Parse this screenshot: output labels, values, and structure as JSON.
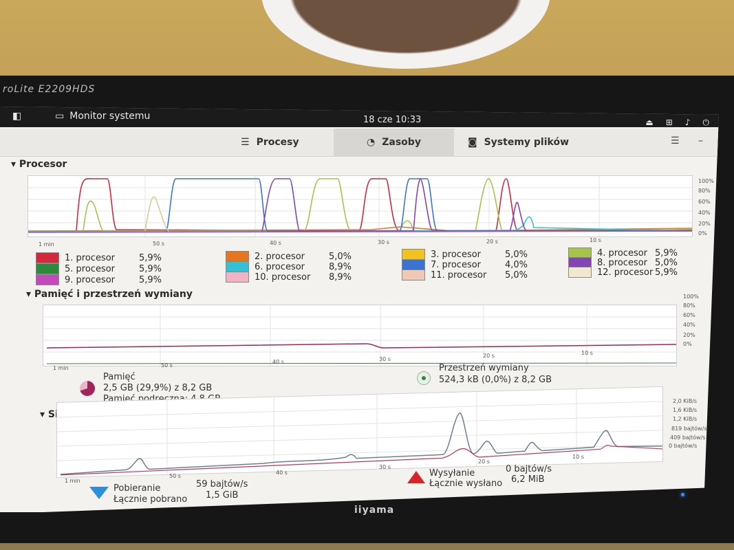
{
  "monitor": {
    "brand_top": "roLite E2209HDS",
    "brand_bottom": "iiyama"
  },
  "topbar": {
    "app_title": "Monitor systemu",
    "clock": "18 cze  10:33"
  },
  "tabs": [
    {
      "label": "Procesy"
    },
    {
      "label": "Zasoby"
    },
    {
      "label": "Systemy plików"
    }
  ],
  "cpu": {
    "title": "Procesor",
    "x_labels": [
      "1 min",
      "50 s",
      "40 s",
      "30 s",
      "20 s",
      "10 s"
    ],
    "y_labels": [
      "100%",
      "80%",
      "60%",
      "40%",
      "20%",
      "0%"
    ],
    "cores": [
      {
        "label": "1. procesor",
        "value": "5,9%",
        "color": "#d4283c"
      },
      {
        "label": "2. procesor",
        "value": "5,0%",
        "color": "#e6761d"
      },
      {
        "label": "3. procesor",
        "value": "5,0%",
        "color": "#f2c31f"
      },
      {
        "label": "4. procesor",
        "value": "5,9%",
        "color": "#a6c34a"
      },
      {
        "label": "5. procesor",
        "value": "5,9%",
        "color": "#2d8a3a"
      },
      {
        "label": "6. procesor",
        "value": "8,9%",
        "color": "#33c1d6"
      },
      {
        "label": "7. procesor",
        "value": "4,0%",
        "color": "#3a74d0"
      },
      {
        "label": "8. procesor",
        "value": "5,0%",
        "color": "#8544b5"
      },
      {
        "label": "9. procesor",
        "value": "5,9%",
        "color": "#c449b9"
      },
      {
        "label": "10. procesor",
        "value": "8,9%",
        "color": "#f0b4c4"
      },
      {
        "label": "11. procesor",
        "value": "5,0%",
        "color": "#efc9b6"
      },
      {
        "label": "12. procesor",
        "value": "5,9%",
        "color": "#f1e9cf"
      }
    ]
  },
  "memory": {
    "title": "Pamięć i przestrzeń wymiany",
    "x_labels": [
      "1 min",
      "50 s",
      "40 s",
      "30 s",
      "20 s",
      "10 s"
    ],
    "y_labels": [
      "100%",
      "80%",
      "60%",
      "40%",
      "20%",
      "0%"
    ],
    "mem_label": "Pamięć",
    "mem_value": "2,5 GB (29,9%) z 8,2 GB",
    "mem_cache": "Pamięć podręczna: 4,8 GB",
    "swap_label": "Przestrzeń wymiany",
    "swap_value": "524,3 kB (0,0%) z 8,2 GB"
  },
  "network": {
    "title": "Sieć",
    "x_labels": [
      "1 min",
      "50 s",
      "40 s",
      "30 s",
      "20 s",
      "10 s"
    ],
    "y_labels": [
      "2,0 KiB/s",
      "1,6 KiB/s",
      "1,2 KiB/s",
      "819 bajtów/s",
      "409 bajtów/s",
      "0 bajtów/s"
    ],
    "down_label": "Pobieranie",
    "down_rate": "59 bajtów/s",
    "down_total_label": "Łącznie pobrano",
    "down_total": "1,5 GiB",
    "up_label": "Wysyłanie",
    "up_rate": "0 bajtów/s",
    "up_total_label": "Łącznie wysłano",
    "up_total": "6,2 MiB"
  }
}
